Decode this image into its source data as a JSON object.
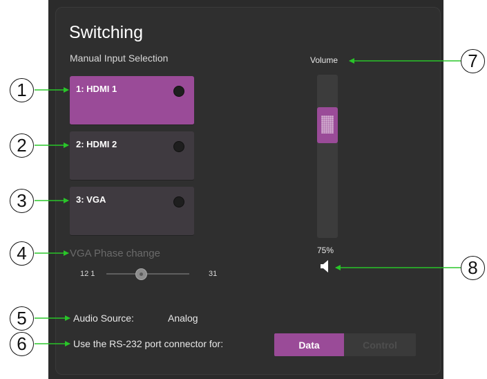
{
  "panel": {
    "title": "Switching",
    "subtitle": "Manual Input Selection"
  },
  "inputs": [
    {
      "label": "1: HDMI 1",
      "active": true
    },
    {
      "label": "2: HDMI 2",
      "active": false
    },
    {
      "label": "3: VGA",
      "active": false
    }
  ],
  "vga_phase": {
    "label": "VGA Phase change",
    "min_label": "12 1",
    "max_label": "31"
  },
  "audio": {
    "label": "Audio Source:",
    "value": "Analog"
  },
  "rs232": {
    "label": "Use the RS-232 port connector for:",
    "options": [
      "Data",
      "Control"
    ],
    "selected": "Data"
  },
  "volume": {
    "label": "Volume",
    "percent_text": "75%",
    "level": 0.75,
    "mute_icon": "speaker-icon"
  },
  "callouts": [
    "1",
    "2",
    "3",
    "4",
    "5",
    "6",
    "7",
    "8"
  ],
  "colors": {
    "accent": "#9a4b98",
    "arrow": "#29c529",
    "panel_bg": "#2f2f2f"
  }
}
